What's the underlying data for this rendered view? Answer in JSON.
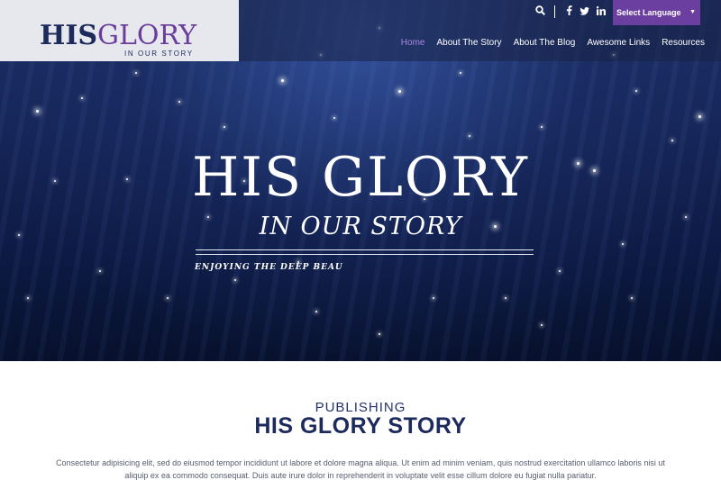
{
  "logo": {
    "his": "HIS",
    "glory": "GLORY",
    "subtitle": "IN OUR STORY"
  },
  "topbar": {
    "icons": [
      "search-icon",
      "facebook-icon",
      "twitter-icon",
      "linkedin-icon"
    ],
    "language_label": "Select Language"
  },
  "nav": {
    "items": [
      "Home",
      "About The Story",
      "About The Blog",
      "Awesome Links",
      "Resources"
    ],
    "active_index": 0
  },
  "hero": {
    "title": "HIS GLORY",
    "subtitle": "IN OUR STORY",
    "tagline": "ENJOYING THE DEEP BEAU"
  },
  "section": {
    "kicker": "PUBLISHING",
    "heading": "HIS GLORY STORY",
    "paragraph": "Consectetur adipisicing elit, sed do eiusmod tempor incididunt ut labore et dolore magna aliqua. Ut enim ad minim veniam, quis nostrud exercitation ullamco laboris nisi ut aliquip ex ea commodo consequat. Duis aute irure dolor in reprehenderit in voluptate velit esse cillum dolore eu fugiat nulla pariatur."
  },
  "colors": {
    "navy": "#1d2b5c",
    "purple": "#6a3fa0",
    "nav_active": "#a987e0"
  }
}
